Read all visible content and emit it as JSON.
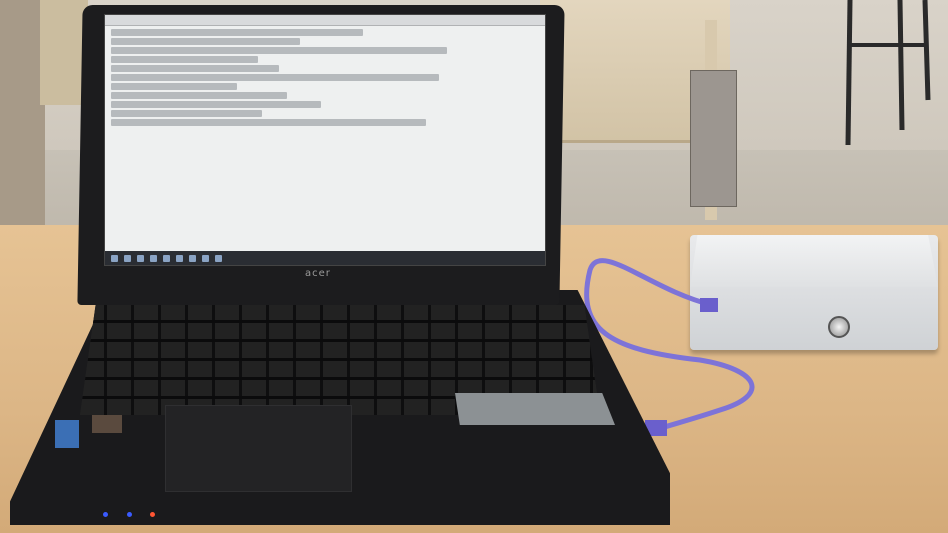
{
  "laptop": {
    "brand_logo": "acer",
    "screen": {
      "taskbar_icons": [
        "start-icon",
        "search-icon",
        "task-view-icon",
        "edge-icon",
        "explorer-icon",
        "store-icon",
        "mail-icon",
        "app-icon",
        "terminal-icon"
      ]
    },
    "led_colors": [
      "#3a5bff",
      "#3a5bff",
      "#ff5533"
    ]
  },
  "cable": {
    "color": "#7d73d8"
  },
  "device": {
    "color": "#dfe1e3"
  }
}
